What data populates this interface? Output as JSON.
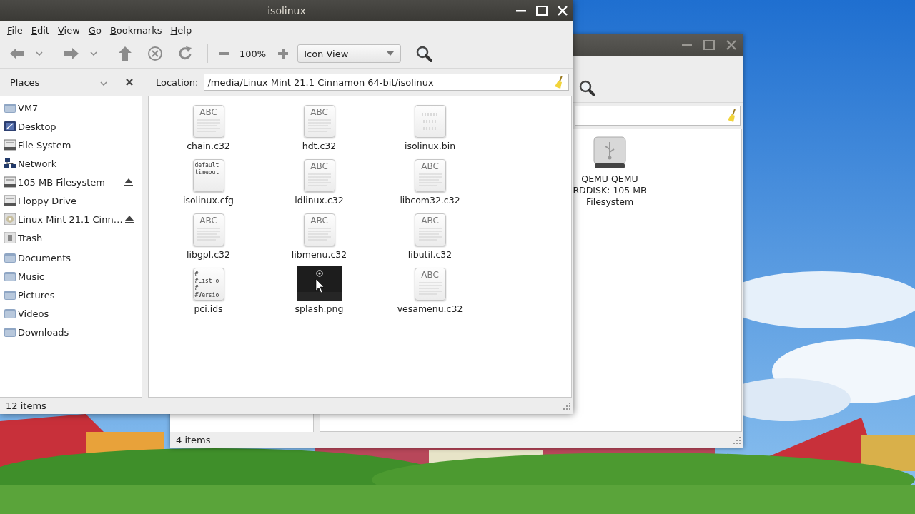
{
  "window": {
    "title": "isolinux",
    "menu": [
      "File",
      "Edit",
      "View",
      "Go",
      "Bookmarks",
      "Help"
    ],
    "toolbar": {
      "zoom": "100%",
      "view_mode": "Icon View"
    },
    "sidebar": {
      "title": "Places",
      "items": [
        {
          "label": "VM7",
          "kind": "folder",
          "eject": false
        },
        {
          "label": "Desktop",
          "kind": "desktop",
          "eject": false
        },
        {
          "label": "File System",
          "kind": "drive",
          "eject": false
        },
        {
          "label": "Network",
          "kind": "network",
          "eject": false
        },
        {
          "label": "105 MB Filesystem",
          "kind": "drive",
          "eject": true
        },
        {
          "label": "Floppy Drive",
          "kind": "drive",
          "eject": false
        },
        {
          "label": "Linux Mint 21.1 Cinn…",
          "kind": "disc",
          "eject": true
        },
        {
          "label": "Trash",
          "kind": "trash",
          "eject": false
        },
        {
          "label": "Documents",
          "kind": "folder",
          "eject": false
        },
        {
          "label": "Music",
          "kind": "folder",
          "eject": false
        },
        {
          "label": "Pictures",
          "kind": "folder",
          "eject": false
        },
        {
          "label": "Videos",
          "kind": "folder",
          "eject": false
        },
        {
          "label": "Downloads",
          "kind": "folder",
          "eject": false
        }
      ]
    },
    "location": {
      "label": "Location:",
      "value": "/media/Linux Mint 21.1 Cinnamon 64-bit/isolinux"
    },
    "files": [
      {
        "name": "chain.c32",
        "kind": "text",
        "icon_text": "ABC"
      },
      {
        "name": "hdt.c32",
        "kind": "text",
        "icon_text": "ABC"
      },
      {
        "name": "isolinux.bin",
        "kind": "binary"
      },
      {
        "name": "isolinux.cfg",
        "kind": "preview",
        "preview": [
          "default",
          "timeout"
        ]
      },
      {
        "name": "ldlinux.c32",
        "kind": "text",
        "icon_text": "ABC"
      },
      {
        "name": "libcom32.c32",
        "kind": "text",
        "icon_text": "ABC"
      },
      {
        "name": "libgpl.c32",
        "kind": "text",
        "icon_text": "ABC"
      },
      {
        "name": "libmenu.c32",
        "kind": "text",
        "icon_text": "ABC"
      },
      {
        "name": "libutil.c32",
        "kind": "text",
        "icon_text": "ABC"
      },
      {
        "name": "pci.ids",
        "kind": "preview",
        "preview": [
          "#",
          "#List o",
          "#",
          "#Versio"
        ]
      },
      {
        "name": "splash.png",
        "kind": "picture"
      },
      {
        "name": "vesamenu.c32",
        "kind": "text",
        "icon_text": "ABC"
      }
    ],
    "status": "12 items"
  },
  "background_window": {
    "items": [
      {
        "kind": "usb",
        "name_lines": [
          "QEMU QEMU",
          "RDDISK: 105 MB",
          "Filesystem"
        ]
      }
    ],
    "status": "4 items"
  }
}
